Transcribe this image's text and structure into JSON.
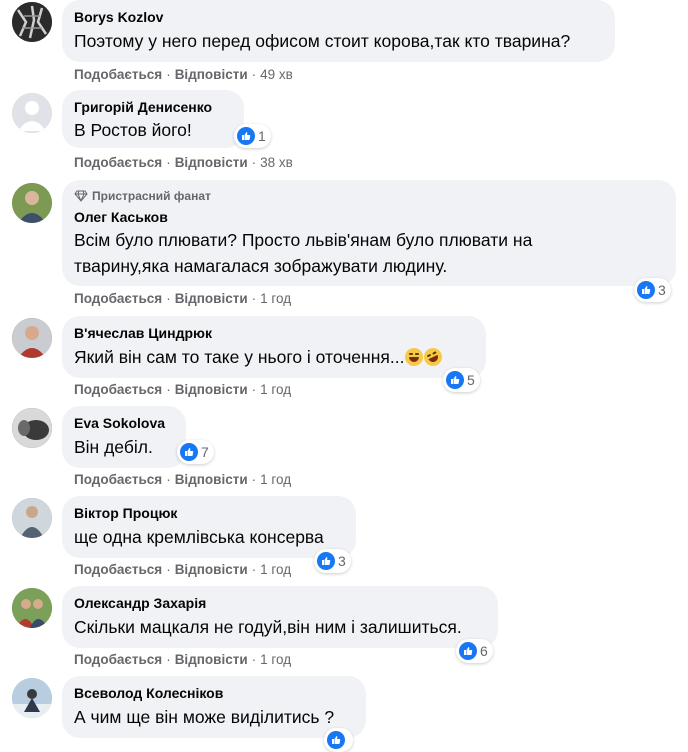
{
  "comments": [
    {
      "author": "Borys Kozlov",
      "text": "Поэтому у него перед офисом стоит корова,так кто тварина?",
      "like_label": "Подобається",
      "reply_label": "Відповісти",
      "time": "49 хв",
      "avatar_color": "#3a3a3a"
    },
    {
      "author": "Григорій Денисенко",
      "text": "В Ростов його!",
      "like_label": "Подобається",
      "reply_label": "Відповісти",
      "time": "38 хв",
      "reactions": "1",
      "avatar_color": "#d0d4d9"
    },
    {
      "badge": "Пристрасний фанат",
      "author": "Олег Каськов",
      "text_line1": "Всім було плювати? Просто львів'янам було плювати на",
      "text_line2": "тварину,яка намагалася зображувати людину.",
      "like_label": "Подобається",
      "reply_label": "Відповісти",
      "time": "1 год",
      "reactions": "3",
      "avatar_color": "#6f8a4a"
    },
    {
      "author": "В'ячеслав Циндрюк",
      "text": "Який він сам то таке у нього і оточення...",
      "like_label": "Подобається",
      "reply_label": "Відповісти",
      "time": "1 год",
      "reactions": "5",
      "avatar_color": "#a5433a"
    },
    {
      "author": "Eva Sokolova",
      "text": "Він дебіл.",
      "like_label": "Подобається",
      "reply_label": "Відповісти",
      "time": "1 год",
      "reactions": "7",
      "avatar_color": "#4a4a4a"
    },
    {
      "author": "Віктор Процюк",
      "text": "ще одна кремлівська консерва",
      "like_label": "Подобається",
      "reply_label": "Відповісти",
      "time": "1 год",
      "reactions": "3",
      "avatar_color": "#7b8a96"
    },
    {
      "author": "Олександр Захарія",
      "text": "Скільки мацкаля не годуй,він ним і залишиться.",
      "like_label": "Подобається",
      "reply_label": "Відповісти",
      "time": "1 год",
      "reactions": "6",
      "avatar_color": "#8a5a3c"
    },
    {
      "author": "Всеволод Колесніков",
      "text": "А чим ще він може виділитись ?",
      "avatar_color": "#9fb4c8"
    }
  ],
  "icons": {
    "like": "like-icon",
    "haha": "haha-icon",
    "fan_badge": "diamond-icon"
  },
  "colors": {
    "bubble": "#f0f2f5",
    "secondary_text": "#65676b",
    "like_blue": "#1877f2"
  }
}
